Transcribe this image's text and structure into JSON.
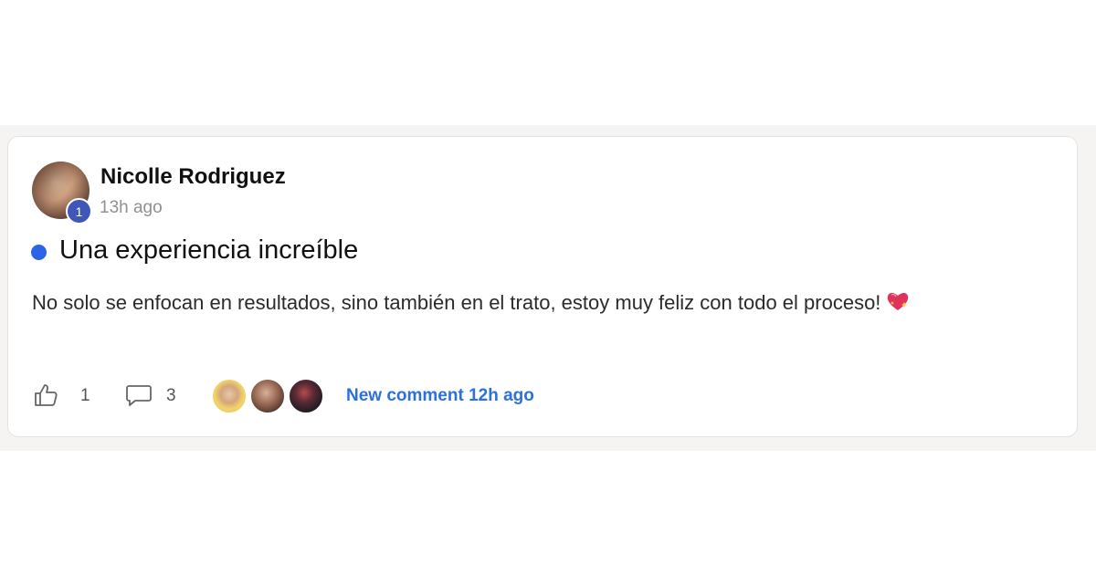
{
  "post": {
    "author": "Nicolle Rodriguez",
    "level": "1",
    "time": "13h ago",
    "title": "Una experiencia increíble",
    "body": "No solo se enfocan en resultados, sino también en el trato, estoy muy feliz con todo el proceso!",
    "body_emoji_icon": "sparkling-heart-icon"
  },
  "footer": {
    "likes": "1",
    "comments": "3",
    "new_comment": "New comment 12h ago",
    "like_icon": "thumbs-up-icon",
    "comment_icon": "speech-bubble-icon"
  },
  "colors": {
    "accent_blue": "#2c6fe0",
    "status_dot": "#2c64e8",
    "level_badge": "#3f57b8"
  }
}
